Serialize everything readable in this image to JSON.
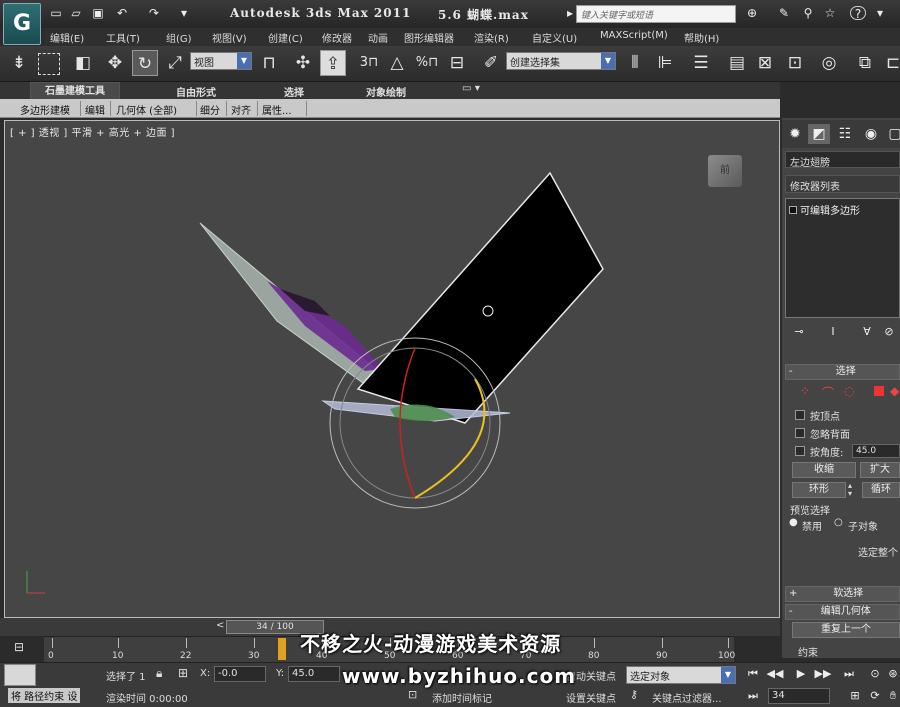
{
  "title_bar": {
    "app_title": "Autodesk 3ds Max  2011",
    "file_title": "5.6 蝴蝶.max",
    "search_placeholder": "键入关键字或短语",
    "help_label": "?"
  },
  "menu": [
    "编辑(E)",
    "工具(T)",
    "组(G)",
    "视图(V)",
    "创建(C)",
    "修改器",
    "动画",
    "图形编辑器",
    "渲染(R)",
    "自定义(U)",
    "MAXScript(M)",
    "帮助(H)"
  ],
  "toolbar": {
    "view_combo": "视图",
    "selection_set": "创建选择集",
    "snap_label": "3",
    "percent_label": "%"
  },
  "ribbon": {
    "tabs": [
      "石墨建模工具",
      "自由形式",
      "选择",
      "对象绘制"
    ],
    "sub_items": [
      "多边形建模",
      "编辑",
      "几何体 (全部)",
      "细分",
      "对齐",
      "属性..."
    ]
  },
  "viewport": {
    "label": "[ + ] 透视 ] 平滑 + 高光 + 边面 ]",
    "viewcube_label": "前"
  },
  "command_panel": {
    "object_name": "左边翅膀",
    "modifier_list": "修改器列表",
    "stack_item": "可编辑多边形",
    "selection_rollout": "选择",
    "by_vertex": "按顶点",
    "ignore_backface": "忽略背面",
    "by_angle": "按角度:",
    "angle_value": "45.0",
    "shrink": "收缩",
    "grow": "扩大",
    "ring": "环形",
    "loop": "循环",
    "preview_selection": "预览选择",
    "disabled": "禁用",
    "sub_object": "子对象",
    "selected_whole": "选定整个",
    "soft_selection": "软选择",
    "edit_geometry": "编辑几何体",
    "repeat_last": "重复上一个",
    "constraints": "约束"
  },
  "timeline": {
    "frame_display": "34 / 100",
    "ticks": [
      "0",
      "10",
      "22",
      "30",
      "40",
      "50",
      "60",
      "70",
      "80",
      "90",
      "100"
    ]
  },
  "status": {
    "selected": "选择了 1",
    "x_label": "X:",
    "x_value": "-0.0",
    "y_label": "Y:",
    "y_value": "45.0",
    "auto_key": "自动关键点",
    "selected_object": "选定对象",
    "set_key": "设置关键点",
    "key_filters": "关键点过滤器...",
    "frame_value": "34",
    "add_time_tag": "添加时间标记",
    "render_time": "渲染时间  0:00:00",
    "bottom_left": "将 路径约束 设"
  },
  "watermark": {
    "line1": "不移之火-动漫游戏美术资源",
    "line2": "www.byzhihuo.com"
  }
}
